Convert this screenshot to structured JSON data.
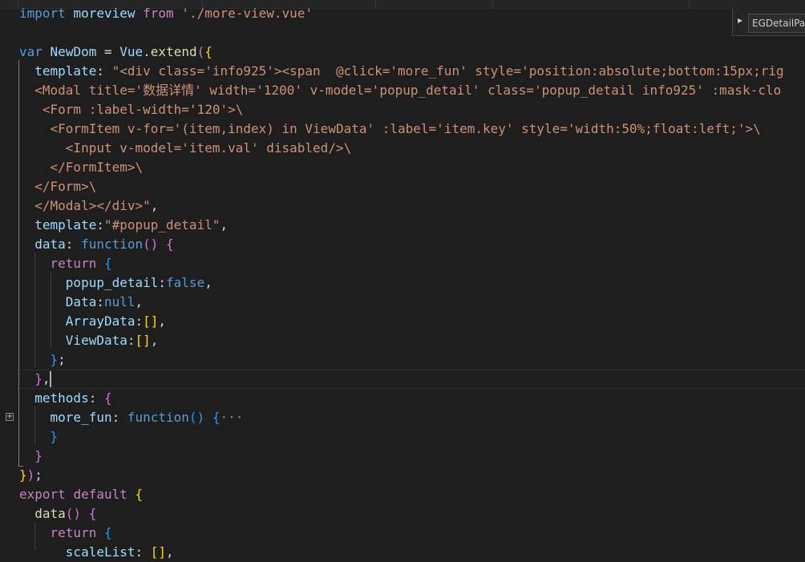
{
  "editor": {
    "language": "vue",
    "lines": [
      {
        "parts": [
          [
            "k",
            "import"
          ],
          [
            "t",
            " "
          ],
          [
            "n",
            "moreview"
          ],
          [
            "t",
            " "
          ],
          [
            "p",
            "from"
          ],
          [
            "t",
            " "
          ],
          [
            "s",
            "'./more-view.vue'"
          ]
        ]
      },
      {
        "parts": []
      },
      {
        "parts": [
          [
            "k",
            "var"
          ],
          [
            "t",
            " "
          ],
          [
            "n",
            "NewDom"
          ],
          [
            "t",
            " = "
          ],
          [
            "n",
            "Vue"
          ],
          [
            "t",
            "."
          ],
          [
            "f",
            "extend"
          ],
          [
            "m",
            "("
          ],
          [
            "y",
            "{"
          ]
        ]
      },
      {
        "parts": [
          [
            "t",
            "  "
          ],
          [
            "n",
            "template"
          ],
          [
            "t",
            ": "
          ],
          [
            "s",
            "\"<div class='info925'><span  @click='more_fun' style='position:absolute;bottom:15px;rig"
          ]
        ]
      },
      {
        "parts": [
          [
            "s",
            "  <Modal title='数据详情' width='1200' v-model='popup_detail' class='popup_detail info925' :mask-clo"
          ]
        ]
      },
      {
        "parts": [
          [
            "s",
            "   <Form :label-width='120'>\\"
          ]
        ]
      },
      {
        "parts": [
          [
            "s",
            "    <FormItem v-for='(item,index) in ViewData' :label='item.key' style='width:50%;float:left;'>\\"
          ]
        ]
      },
      {
        "parts": [
          [
            "s",
            "      <Input v-model='item.val' disabled/>\\"
          ]
        ]
      },
      {
        "parts": [
          [
            "s",
            "    </FormItem>\\"
          ]
        ]
      },
      {
        "parts": [
          [
            "s",
            "  </Form>\\"
          ]
        ]
      },
      {
        "parts": [
          [
            "s",
            "  </Modal></div>\""
          ],
          [
            "t",
            ","
          ]
        ]
      },
      {
        "parts": [
          [
            "t",
            "  "
          ],
          [
            "n",
            "template"
          ],
          [
            "t",
            ":"
          ],
          [
            "s",
            "\"#popup_detail\""
          ],
          [
            "t",
            ","
          ]
        ]
      },
      {
        "parts": [
          [
            "t",
            "  "
          ],
          [
            "n",
            "data"
          ],
          [
            "t",
            ": "
          ],
          [
            "k",
            "function"
          ],
          [
            "m",
            "()"
          ],
          [
            "t",
            " "
          ],
          [
            "m",
            "{"
          ]
        ]
      },
      {
        "parts": [
          [
            "t",
            "    "
          ],
          [
            "p",
            "return"
          ],
          [
            "t",
            " "
          ],
          [
            "b",
            "{"
          ]
        ]
      },
      {
        "parts": [
          [
            "t",
            "      "
          ],
          [
            "n",
            "popup_detail"
          ],
          [
            "t",
            ":"
          ],
          [
            "k",
            "false"
          ],
          [
            "t",
            ","
          ]
        ]
      },
      {
        "parts": [
          [
            "t",
            "      "
          ],
          [
            "n",
            "Data"
          ],
          [
            "t",
            ":"
          ],
          [
            "k",
            "null"
          ],
          [
            "t",
            ","
          ]
        ]
      },
      {
        "parts": [
          [
            "t",
            "      "
          ],
          [
            "n",
            "ArrayData"
          ],
          [
            "t",
            ":"
          ],
          [
            "y",
            "[]"
          ],
          [
            "t",
            ","
          ]
        ]
      },
      {
        "parts": [
          [
            "t",
            "      "
          ],
          [
            "n",
            "ViewData"
          ],
          [
            "t",
            ":"
          ],
          [
            "y",
            "[]"
          ],
          [
            "t",
            ","
          ]
        ]
      },
      {
        "parts": [
          [
            "t",
            "    "
          ],
          [
            "b",
            "}"
          ],
          [
            "t",
            ";"
          ]
        ]
      },
      {
        "parts": [
          [
            "t",
            "  "
          ],
          [
            "m",
            "}"
          ],
          [
            "t",
            ","
          ]
        ]
      },
      {
        "parts": [
          [
            "t",
            "  "
          ],
          [
            "n",
            "methods"
          ],
          [
            "t",
            ": "
          ],
          [
            "m",
            "{"
          ]
        ]
      },
      {
        "parts": [
          [
            "t",
            "    "
          ],
          [
            "n",
            "more_fun"
          ],
          [
            "t",
            ": "
          ],
          [
            "k",
            "function"
          ],
          [
            "b",
            "()"
          ],
          [
            "t",
            " "
          ],
          [
            "b",
            "{"
          ],
          [
            "fold-dots",
            "···"
          ]
        ]
      },
      {
        "parts": [
          [
            "t",
            "    "
          ],
          [
            "b",
            "}"
          ]
        ]
      },
      {
        "parts": [
          [
            "t",
            "  "
          ],
          [
            "m",
            "}"
          ]
        ]
      },
      {
        "parts": [
          [
            "y",
            "}"
          ],
          [
            "m",
            ")"
          ],
          [
            "t",
            ";"
          ]
        ]
      },
      {
        "parts": [
          [
            "p",
            "export"
          ],
          [
            "t",
            " "
          ],
          [
            "p",
            "default"
          ],
          [
            "t",
            " "
          ],
          [
            "y",
            "{"
          ]
        ]
      },
      {
        "parts": [
          [
            "t",
            "  "
          ],
          [
            "f",
            "data"
          ],
          [
            "m",
            "()"
          ],
          [
            "t",
            " "
          ],
          [
            "m",
            "{"
          ]
        ]
      },
      {
        "parts": [
          [
            "t",
            "    "
          ],
          [
            "p",
            "return"
          ],
          [
            "t",
            " "
          ],
          [
            "b",
            "{"
          ]
        ]
      },
      {
        "parts": [
          [
            "t",
            "      "
          ],
          [
            "n",
            "scaleList"
          ],
          [
            "t",
            ": "
          ],
          [
            "y",
            "[]"
          ],
          [
            "t",
            ","
          ]
        ]
      }
    ]
  },
  "breadcrumb_popup": {
    "chevron_icon": "chevron-right-icon",
    "label": "EGDetailPag"
  },
  "fold": {
    "icon": "expand-plus-icon",
    "symbol": "+"
  },
  "colors": {
    "background": "#1e1e1e",
    "keyword": "#569cd6",
    "control": "#c586c0",
    "variable": "#9cdcfe",
    "function": "#dcdcaa",
    "string": "#ce9178"
  }
}
